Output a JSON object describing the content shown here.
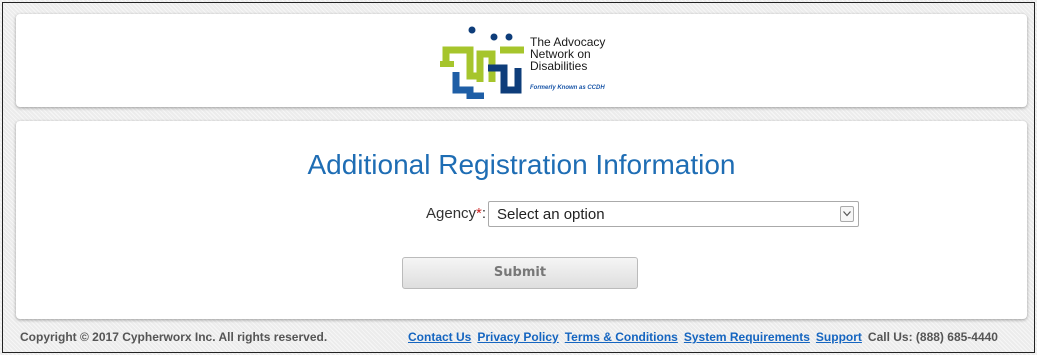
{
  "header": {
    "logo": {
      "name_lines": [
        "The Advocacy",
        "Network on",
        "Disabilities"
      ],
      "tagline": "Formerly Known as CCDH",
      "colors": {
        "green": "#a6c52c",
        "blue": "#1e5ea6",
        "navy": "#0e3d7a"
      }
    }
  },
  "form": {
    "title": "Additional Registration Information",
    "agency_label": "Agency",
    "required_marker": "*",
    "label_colon": ":",
    "agency_select": {
      "selected": "Select an option"
    },
    "submit_label": "Submit"
  },
  "footer": {
    "copyright": "Copyright © 2017 Cypherworx Inc. All rights reserved.",
    "links": [
      "Contact Us",
      "Privacy Policy",
      "Terms & Conditions",
      "System Requirements",
      "Support"
    ],
    "phone": "Call Us: (888) 685-4440"
  },
  "colors": {
    "title": "#1e6db4",
    "link": "#1565c0",
    "required": "#cc2222"
  }
}
